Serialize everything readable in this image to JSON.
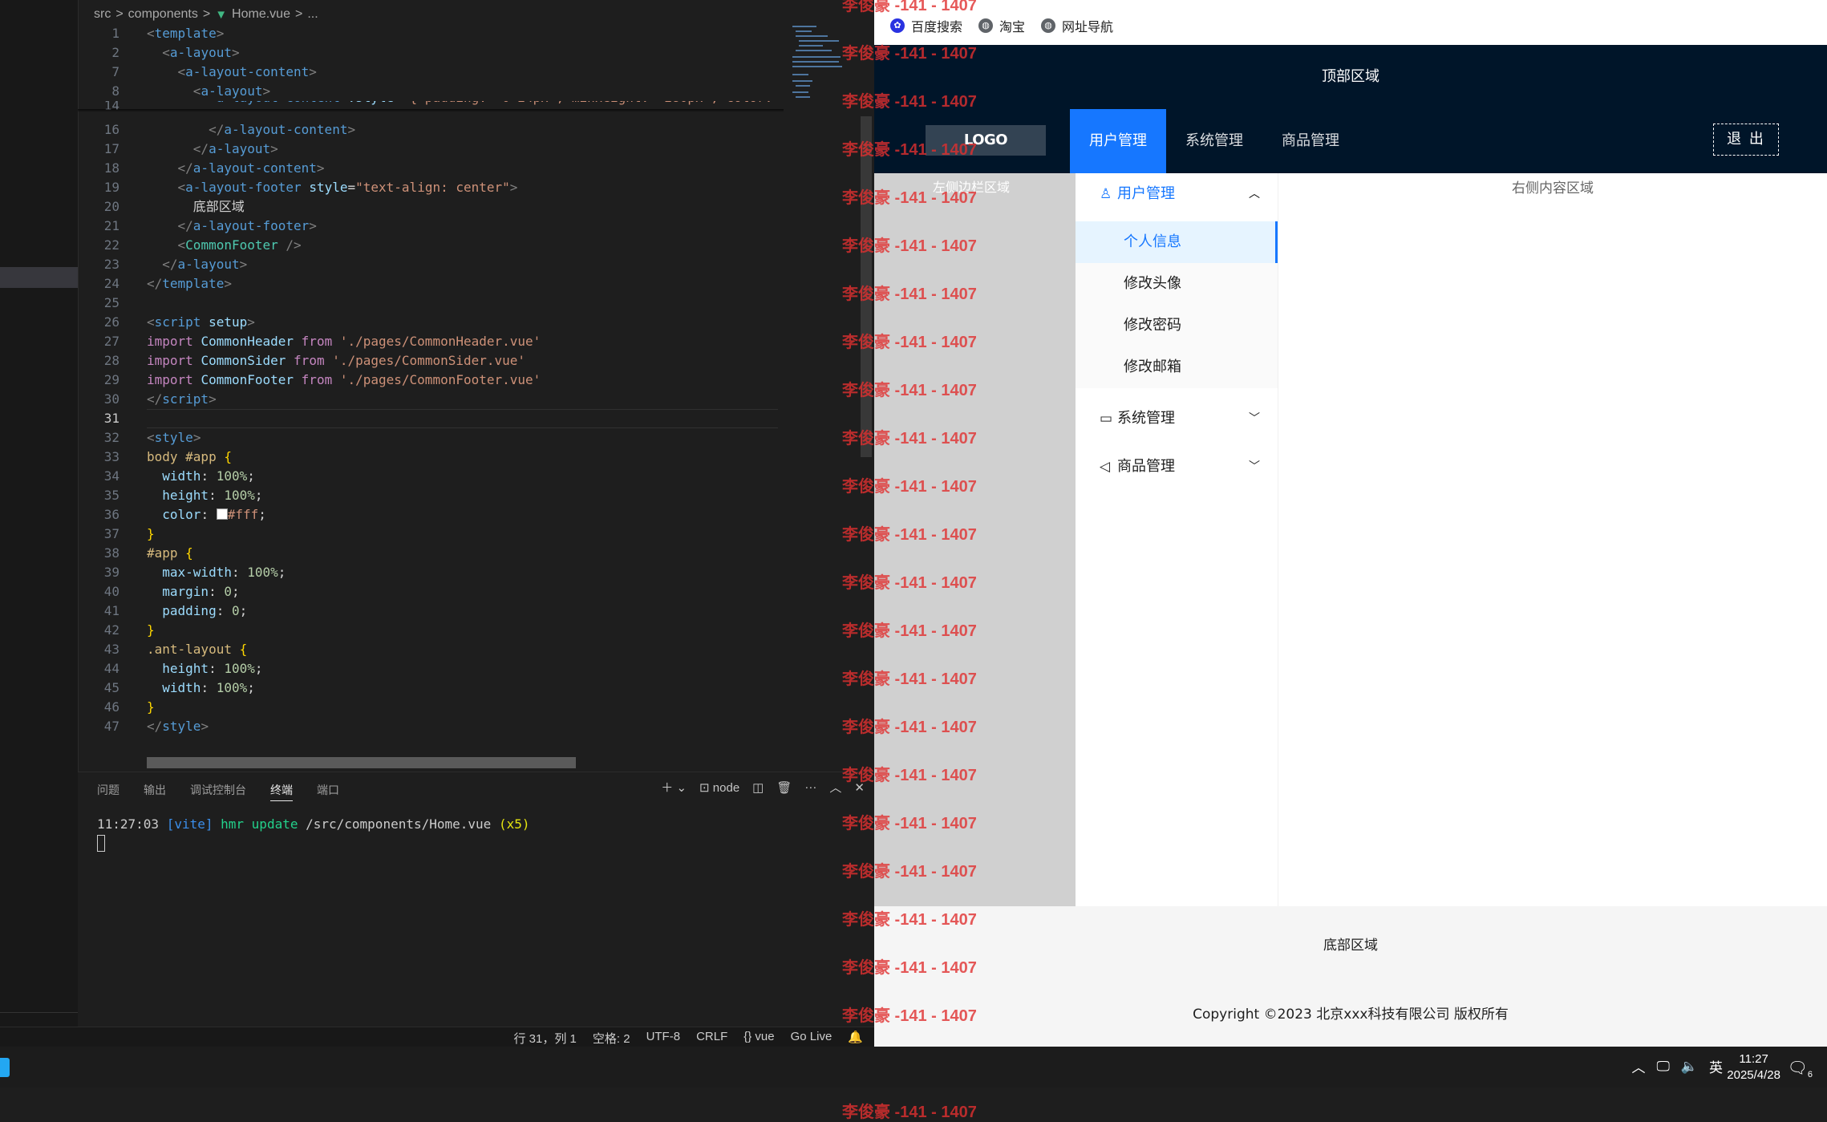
{
  "editor": {
    "breadcrumb": [
      "src",
      ">",
      "components",
      ">",
      "Home.vue",
      ">",
      "..."
    ],
    "line_numbers": [
      "1",
      "2",
      "7",
      "8",
      "14",
      "16",
      "17",
      "18",
      "19",
      "20",
      "21",
      "22",
      "23",
      "24",
      "25",
      "26",
      "27",
      "28",
      "29",
      "30",
      "31",
      "32",
      "33",
      "34",
      "35",
      "36",
      "37",
      "38",
      "39",
      "40",
      "41",
      "42",
      "43",
      "44",
      "45",
      "46",
      "47"
    ],
    "current_line": "31",
    "panel_tabs": [
      "问题",
      "输出",
      "调试控制台",
      "终端",
      "端口"
    ],
    "panel_active_tab": "终端",
    "terminal_shell": "node",
    "terminal": {
      "time": "11:27:03",
      "vite": "[vite]",
      "hmr": "hmr update",
      "path": "/src/components/Home.vue",
      "count": "(x5)"
    },
    "status": [
      "行 31，列 1",
      "空格: 2",
      "UTF-8",
      "CRLF",
      "{} vue",
      "Go Live"
    ]
  },
  "browser": {
    "bookmarks": [
      "百度搜索",
      "淘宝",
      "网址导航"
    ],
    "top_area": "顶部区域",
    "logo": "LOGO",
    "nav": [
      "用户管理",
      "系统管理",
      "商品管理"
    ],
    "logout": "退 出",
    "left_area": "左侧边栏区域",
    "menu": {
      "user_mgmt": "用户管理",
      "sub": [
        "个人信息",
        "修改头像",
        "修改密码",
        "修改邮箱"
      ],
      "system_mgmt": "系统管理",
      "goods_mgmt": "商品管理"
    },
    "right_content": "右侧内容区域",
    "footer_area": "底部区域",
    "copyright": "Copyright ©2023 北京xxx科技有限公司 版权所有"
  },
  "watermark_text": "李俊豪 -141 - 1407",
  "taskbar": {
    "ime": "英",
    "time": "11:27",
    "date": "2025/4/28",
    "notifications": "6"
  },
  "colors": {
    "header_bg": "#001529",
    "accent": "#1677ff",
    "editor_bg": "#1e1e1e",
    "watermark": "#e03030"
  }
}
